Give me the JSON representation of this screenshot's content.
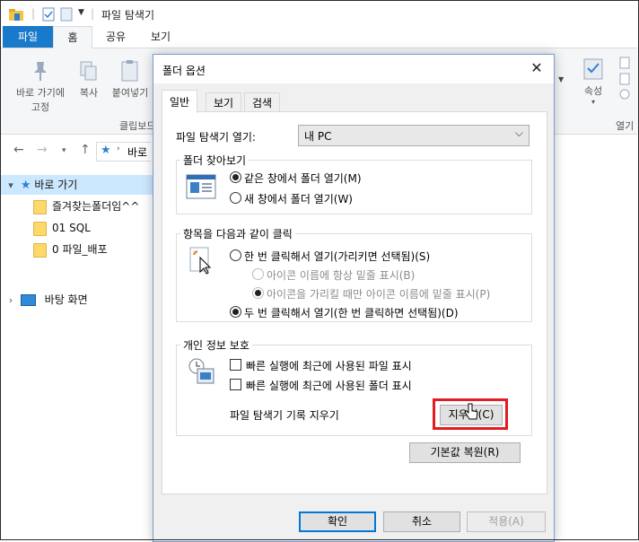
{
  "explorer": {
    "title": "파일 탐색기",
    "tabs": {
      "file": "파일",
      "home": "홈",
      "share": "공유",
      "view": "보기"
    },
    "ribbon": {
      "pin_label_1": "바로 가기에",
      "pin_label_2": "고정",
      "copy": "복사",
      "paste": "붙여넣기",
      "clipboard_group": "클립보드",
      "properties": "속성",
      "open_group": "열기"
    },
    "address_crumb": "바로",
    "nav": {
      "quick_access": "바로 가기",
      "items": [
        "즐겨찾는폴더임^^",
        "01 SQL",
        "0 파일_배포"
      ],
      "desktop": "바탕 화면"
    }
  },
  "dialog": {
    "title": "폴더 옵션",
    "close": "✕",
    "tabs": [
      "일반",
      "보기",
      "검색"
    ],
    "open_explorer_label": "파일 탐색기 열기:",
    "open_explorer_value": "내 PC",
    "browse_group": "폴더 찾아보기",
    "browse_same": "같은 창에서 폴더 열기(M)",
    "browse_new": "새 창에서 폴더 열기(W)",
    "click_group": "항목을 다음과 같이 클릭",
    "single_click": "한 번 클릭해서 열기(가리키면 선택됨)(S)",
    "underline_always": "아이콘 이름에 항상 밑줄 표시(B)",
    "underline_hover": "아이콘을 가리킬 때만 아이콘 이름에 밑줄 표시(P)",
    "double_click": "두 번 클릭해서 열기(한 번 클릭하면 선택됨)(D)",
    "privacy_group": "개인 정보 보호",
    "recent_files": "빠른 실행에 최근에 사용된 파일 표시",
    "recent_folders": "빠른 실행에 최근에 사용된 폴더 표시",
    "clear_history_label": "파일 탐색기 기록 지우기",
    "clear_button": "지우기(C)",
    "restore_defaults": "기본값 복원(R)",
    "ok": "확인",
    "cancel": "취소",
    "apply": "적용(A)"
  },
  "colors": {
    "accent": "#1979ca",
    "highlight": "#e31b23",
    "selection": "#cce8ff"
  }
}
